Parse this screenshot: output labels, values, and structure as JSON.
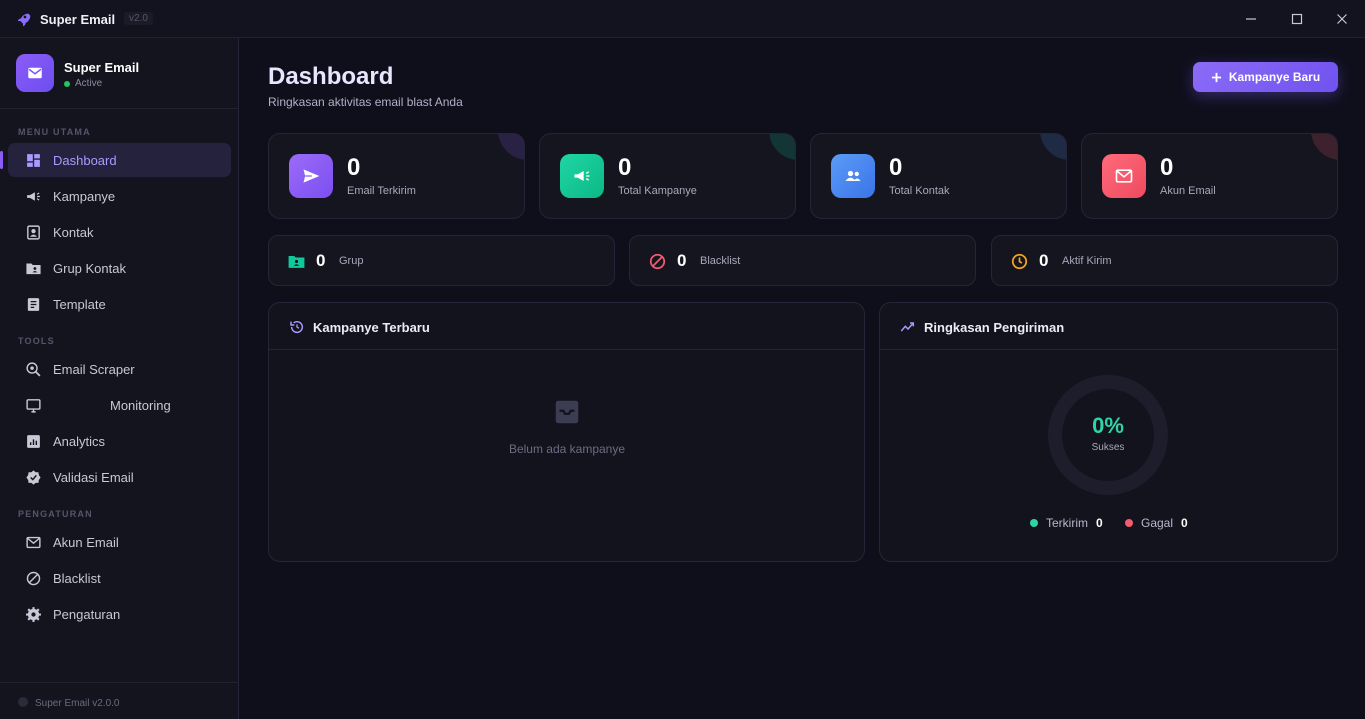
{
  "window": {
    "title": "Super Email",
    "version": "v2.0"
  },
  "sidebar": {
    "brand_name": "Super Email",
    "brand_status": "Active",
    "sections": {
      "main": "MENU UTAMA",
      "tools": "TOOLS",
      "settings": "PENGATURAN"
    },
    "items": [
      {
        "label": "Dashboard",
        "icon": "dashboard-icon",
        "active": true
      },
      {
        "label": "Kampanye",
        "icon": "megaphone-icon"
      },
      {
        "label": "Kontak",
        "icon": "contact-icon"
      },
      {
        "label": "Grup Kontak",
        "icon": "folder-user-icon"
      },
      {
        "label": "Template",
        "icon": "document-icon"
      },
      {
        "label": "Email Scraper",
        "icon": "scraper-icon"
      },
      {
        "label": "Monitoring",
        "icon": "monitor-icon"
      },
      {
        "label": "Analytics",
        "icon": "analytics-icon"
      },
      {
        "label": "Validasi Email",
        "icon": "verified-icon"
      },
      {
        "label": "Akun Email",
        "icon": "mail-icon"
      },
      {
        "label": "Blacklist",
        "icon": "block-icon"
      },
      {
        "label": "Pengaturan",
        "icon": "gear-icon"
      }
    ],
    "footer": "Super Email v2.0.0"
  },
  "header": {
    "title": "Dashboard",
    "subtitle": "Ringkasan aktivitas email blast Anda",
    "new_campaign_label": "Kampanye Baru"
  },
  "stats": [
    {
      "value": "0",
      "label": "Email Terkirim",
      "color": "#8b5cf6"
    },
    {
      "value": "0",
      "label": "Total Kampanye",
      "color": "#10c99a"
    },
    {
      "value": "0",
      "label": "Total Kontak",
      "color": "#4b8bf5"
    },
    {
      "value": "0",
      "label": "Akun Email",
      "color": "#f25c6e"
    }
  ],
  "mini_stats": [
    {
      "value": "0",
      "label": "Grup",
      "color": "#10c99a"
    },
    {
      "value": "0",
      "label": "Blacklist",
      "color": "#f25c6e"
    },
    {
      "value": "0",
      "label": "Aktif Kirim",
      "color": "#f5a524"
    }
  ],
  "recent_campaigns": {
    "title": "Kampanye Terbaru",
    "empty_text": "Belum ada kampanye"
  },
  "delivery_summary": {
    "title": "Ringkasan Pengiriman",
    "percent": "0%",
    "percent_label": "Sukses",
    "success_fraction": 0,
    "legend": [
      {
        "label": "Terkirim",
        "value": "0",
        "color": "#2fd4a6"
      },
      {
        "label": "Gagal",
        "value": "0",
        "color": "#f25c6e"
      }
    ]
  }
}
